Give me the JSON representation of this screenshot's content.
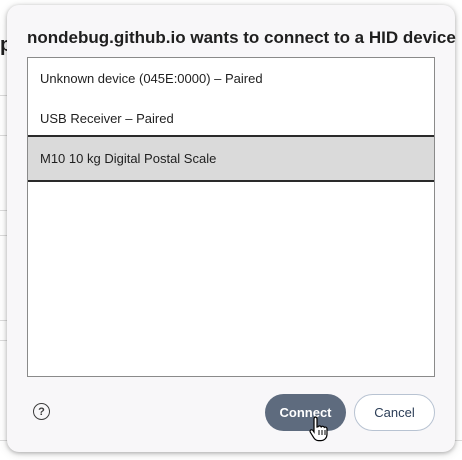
{
  "dialog": {
    "title": "nondebug.github.io wants to connect to a HID device",
    "devices": [
      {
        "label": "Unknown device (045E:0000) – Paired",
        "selected": false
      },
      {
        "label": "USB Receiver – Paired",
        "selected": false
      },
      {
        "label": "M10 10 kg Digital Postal Scale",
        "selected": true
      }
    ],
    "help_icon": "question-circle-icon",
    "buttons": {
      "connect_label": "Connect",
      "cancel_label": "Cancel"
    }
  },
  "background": {
    "partial_glyph": "p"
  },
  "colors": {
    "dialog_bg": "#f8f7f9",
    "selected_row": "#dadada",
    "connect_button": "#5e6b7e",
    "cancel_border": "#b8c3d2"
  }
}
